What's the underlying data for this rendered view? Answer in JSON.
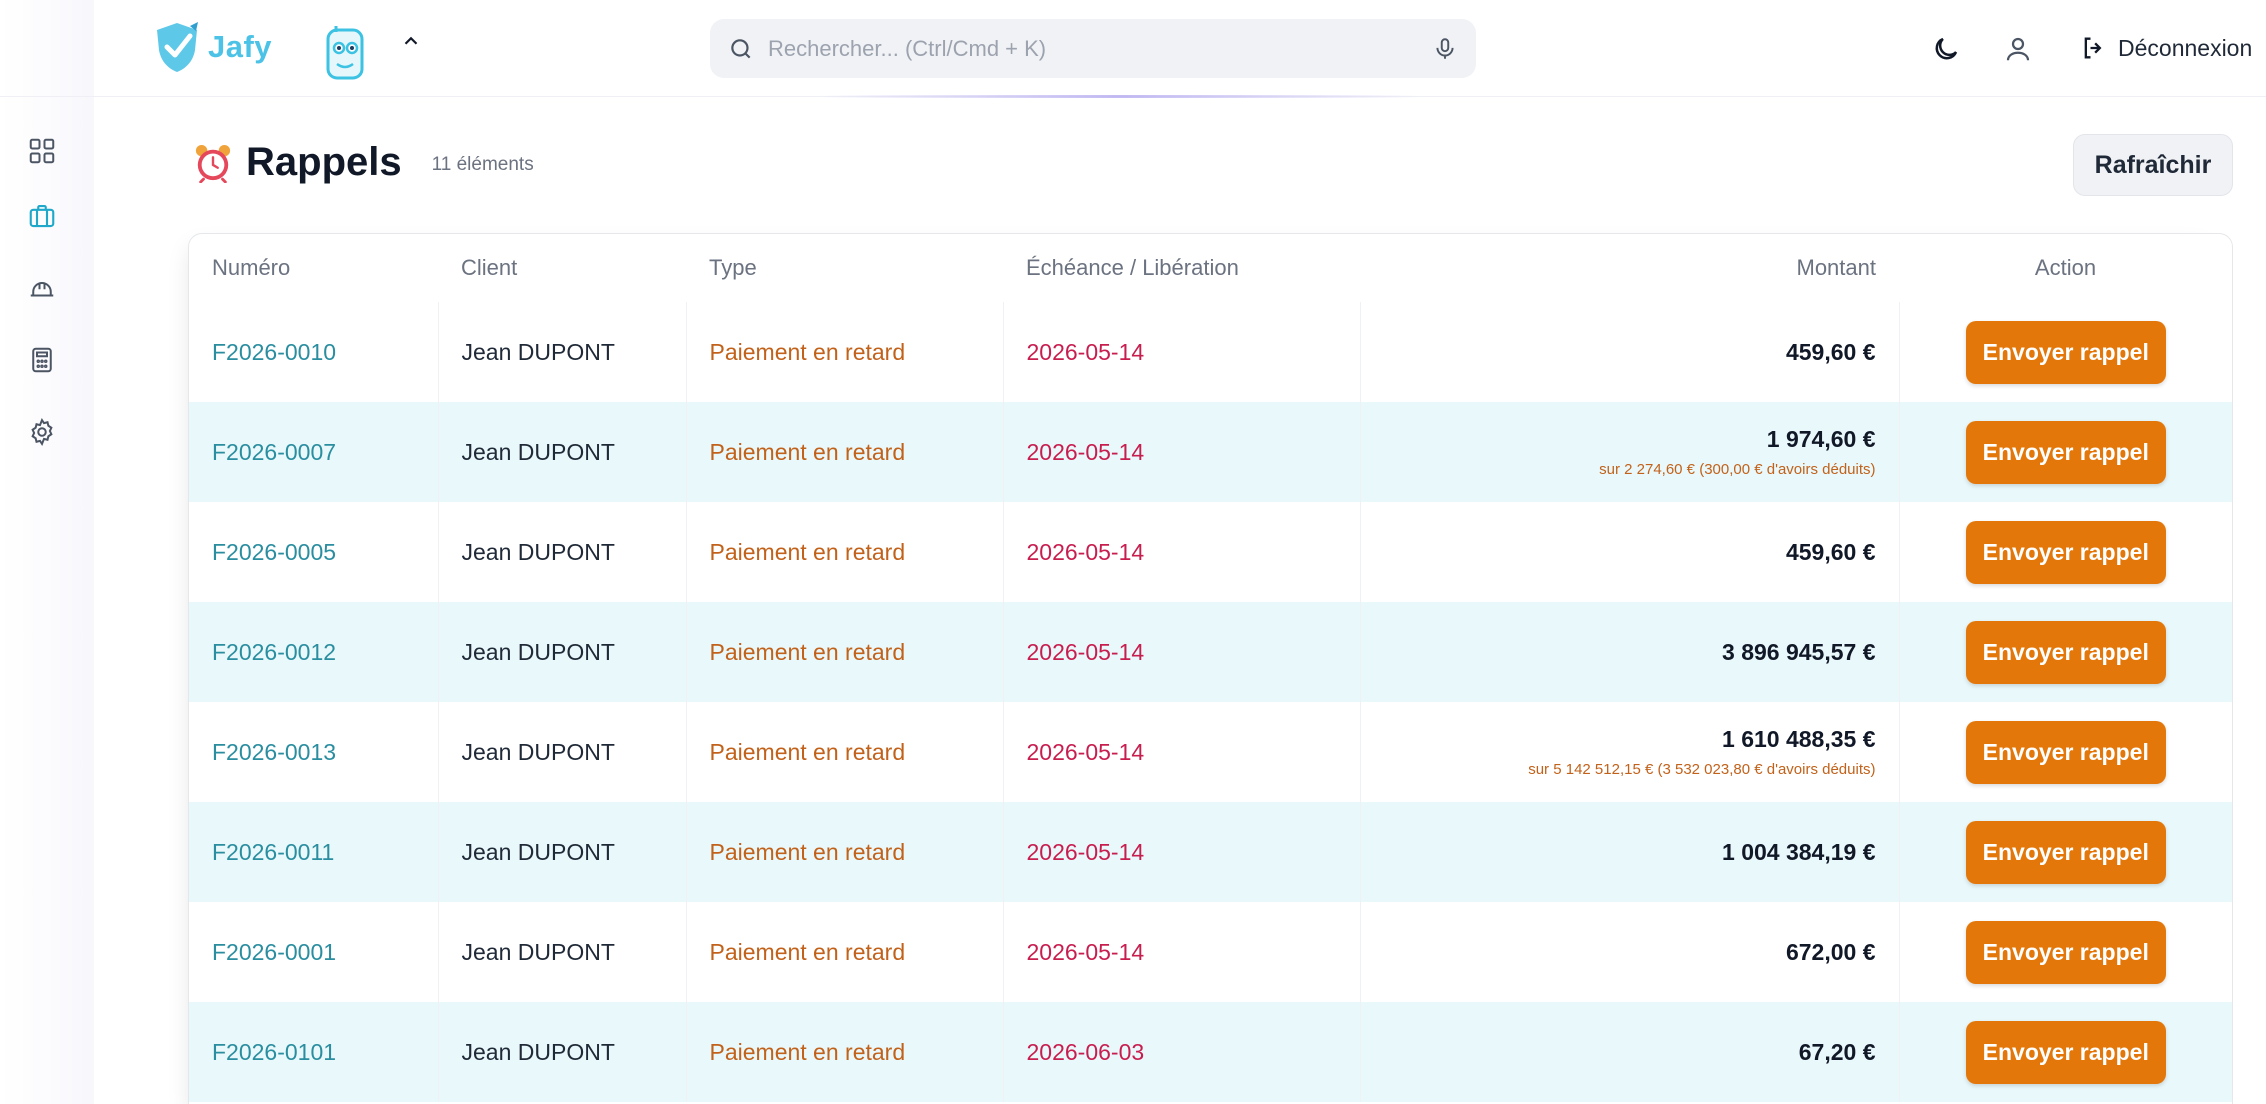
{
  "header": {
    "logo_text": "Jafy",
    "search_placeholder": "Rechercher... (Ctrl/Cmd + K)",
    "logout_label": "Déconnexion"
  },
  "page": {
    "title": "Rappels",
    "count": "11 éléments",
    "refresh_label": "Rafraîchir"
  },
  "table": {
    "columns": {
      "numero": "Numéro",
      "client": "Client",
      "type": "Type",
      "echeance": "Échéance / Libération",
      "montant": "Montant",
      "action": "Action"
    },
    "action_label": "Envoyer rappel",
    "rows": [
      {
        "numero": "F2026-0010",
        "client": "Jean DUPONT",
        "type": "Paiement en retard",
        "date": "2026-05-14",
        "montant": "459,60 €",
        "note": ""
      },
      {
        "numero": "F2026-0007",
        "client": "Jean DUPONT",
        "type": "Paiement en retard",
        "date": "2026-05-14",
        "montant": "1 974,60 €",
        "note": "sur 2 274,60 € (300,00 € d'avoirs déduits)"
      },
      {
        "numero": "F2026-0005",
        "client": "Jean DUPONT",
        "type": "Paiement en retard",
        "date": "2026-05-14",
        "montant": "459,60 €",
        "note": ""
      },
      {
        "numero": "F2026-0012",
        "client": "Jean DUPONT",
        "type": "Paiement en retard",
        "date": "2026-05-14",
        "montant": "3 896 945,57 €",
        "note": ""
      },
      {
        "numero": "F2026-0013",
        "client": "Jean DUPONT",
        "type": "Paiement en retard",
        "date": "2026-05-14",
        "montant": "1 610 488,35 €",
        "note": "sur 5 142 512,15 € (3 532 023,80 € d'avoirs déduits)"
      },
      {
        "numero": "F2026-0011",
        "client": "Jean DUPONT",
        "type": "Paiement en retard",
        "date": "2026-05-14",
        "montant": "1 004 384,19 €",
        "note": ""
      },
      {
        "numero": "F2026-0001",
        "client": "Jean DUPONT",
        "type": "Paiement en retard",
        "date": "2026-05-14",
        "montant": "672,00 €",
        "note": ""
      },
      {
        "numero": "F2026-0101",
        "client": "Jean DUPONT",
        "type": "Paiement en retard",
        "date": "2026-06-03",
        "montant": "67,20 €",
        "note": ""
      }
    ]
  },
  "colors": {
    "accent_orange": "#e37709",
    "link_teal": "#2a8ea0",
    "date_red": "#c81e4f",
    "row_stripe": "#e9f8fa"
  },
  "icons": {
    "sidebar": [
      "dashboard-icon",
      "briefcase-icon",
      "helmet-icon",
      "calculator-icon",
      "settings-icon"
    ],
    "header": [
      "search-icon",
      "microphone-icon",
      "moon-icon",
      "user-icon",
      "logout-icon"
    ]
  }
}
